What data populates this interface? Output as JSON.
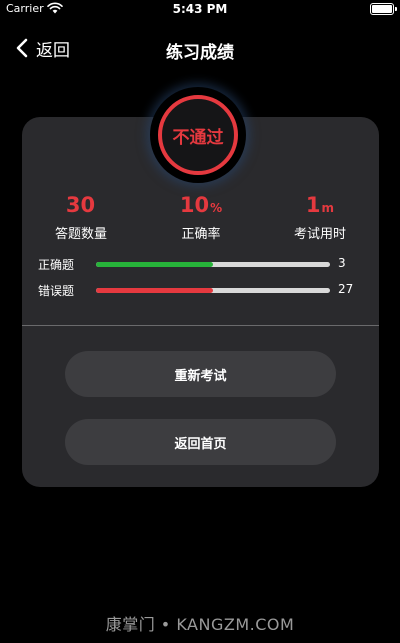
{
  "status_bar": {
    "carrier": "Carrier",
    "time": "5:43 PM"
  },
  "nav": {
    "back_label": "返回",
    "title": "练习成绩"
  },
  "result": {
    "badge_text": "不通过",
    "badge_color": "#e5393f"
  },
  "stats": [
    {
      "value": "30",
      "unit": "",
      "label": "答题数量"
    },
    {
      "value": "10",
      "unit": "%",
      "label": "正确率"
    },
    {
      "value": "1",
      "unit": "m",
      "label": "考试用时"
    }
  ],
  "progress": {
    "correct": {
      "label": "正确题",
      "count": "3",
      "fraction": 0.5,
      "color": "#27b33a"
    },
    "wrong": {
      "label": "错误题",
      "count": "27",
      "fraction": 0.5,
      "color": "#e5393f"
    }
  },
  "buttons": {
    "retry_label": "重新考试",
    "home_label": "返回首页"
  },
  "watermark": "康掌门 • KANGZM.COM"
}
